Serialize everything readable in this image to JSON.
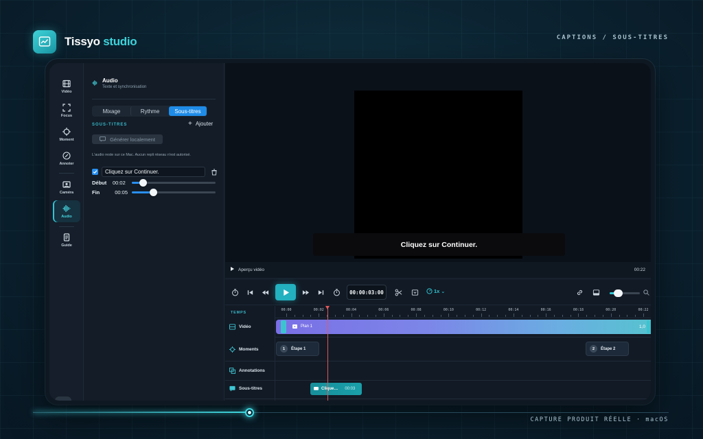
{
  "brand": {
    "name_prefix": "Tissyo",
    "name_accent": "studio"
  },
  "top_caption": "CAPTIONS / SOUS-TITRES",
  "bottom_caption": "CAPTURE PRODUIT RÉELLE · macOS",
  "slide_progress": 0.34,
  "rail": [
    {
      "label": "Vidéo",
      "icon": "film-icon",
      "active": false
    },
    {
      "label": "Focus",
      "icon": "focus-frame-icon",
      "active": false
    },
    {
      "label": "Moment",
      "icon": "crosshair-icon",
      "active": false
    },
    {
      "label": "Annoter",
      "icon": "pen-circle-icon",
      "active": false
    },
    {
      "label": "Caméra",
      "icon": "camera-icon",
      "active": false
    },
    {
      "label": "Audio",
      "icon": "waveform-icon",
      "active": true
    },
    {
      "label": "Guide",
      "icon": "document-icon",
      "active": false
    }
  ],
  "panel": {
    "title": "Audio",
    "subtitle": "Texte et synchronisation",
    "tabs": [
      "Mixage",
      "Rythme",
      "Sous-titres"
    ],
    "active_tab": "Sous-titres",
    "section_label": "SOUS-TITRES",
    "add_label": "Ajouter",
    "generate_label": "Générer localement",
    "note": "L'audio reste sur ce Mac. Aucun repli réseau n'est autorisé.",
    "caption": {
      "checked": true,
      "text": "Cliquez sur Continuer."
    },
    "start": {
      "label": "Début",
      "value": "00:02",
      "fraction": 0.13
    },
    "end": {
      "label": "Fin",
      "value": "00:05",
      "fraction": 0.25
    }
  },
  "preview": {
    "subtitle_text": "Cliquez sur Continuer.",
    "label": "Aperçu vidéo",
    "duration": "00:22"
  },
  "transport": {
    "timecode": "00:00:03:00",
    "speed": "1x",
    "zoom_fraction": 0.28
  },
  "timeline": {
    "header_label": "TEMPS",
    "ticks": [
      "00:00",
      "00:02",
      "00:04",
      "00:06",
      "00:08",
      "00:10",
      "00:12",
      "00:14",
      "00:16",
      "00:18",
      "00:20",
      "00:22"
    ],
    "tracks": [
      {
        "label": "Vidéo",
        "icon": "film-icon"
      },
      {
        "label": "Moments",
        "icon": "crosshair-icon"
      },
      {
        "label": "Annotations",
        "icon": "layers-icon"
      },
      {
        "label": "Sous-titres",
        "icon": "caption-icon"
      }
    ],
    "video_clip": {
      "name": "Plan 1",
      "end_label": "1,0"
    },
    "moments": [
      {
        "num": "1",
        "label": "Étape 1"
      },
      {
        "num": "2",
        "label": "Étape 2"
      }
    ],
    "subtitle_clip": {
      "label": "Clique…",
      "time": "00:03"
    }
  },
  "colors": {
    "accent": "#2fc7d5",
    "primary_blue": "#1f8ce8",
    "playhead": "#e25a5a"
  }
}
